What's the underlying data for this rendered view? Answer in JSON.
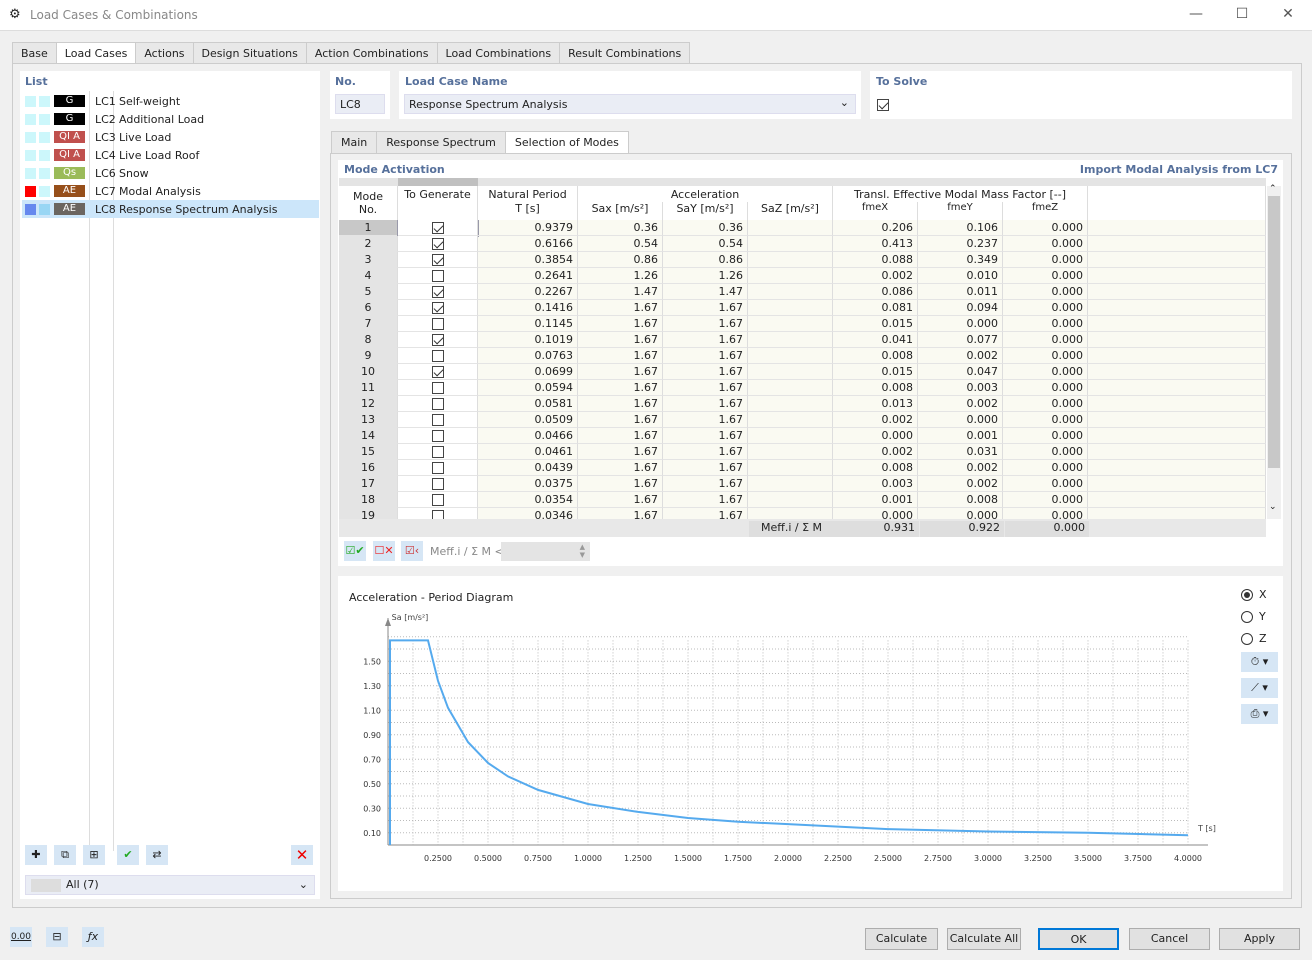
{
  "window": {
    "title": "Load Cases & Combinations",
    "minimize": "—",
    "maximize": "☐",
    "close": "✕"
  },
  "tabs": [
    "Base",
    "Load Cases",
    "Actions",
    "Design Situations",
    "Action Combinations",
    "Load Combinations",
    "Result Combinations"
  ],
  "active_tab": 1,
  "list": {
    "header": "List",
    "filter": "All (7)",
    "items": [
      {
        "id": "LC1",
        "name": "Self-weight",
        "badge": "G",
        "badge_color": "#000000",
        "c1": "#ccf7fb",
        "c2": "#ccf7fb"
      },
      {
        "id": "LC2",
        "name": "Additional Load",
        "badge": "G",
        "badge_color": "#000000",
        "c1": "#ccf7fb",
        "c2": "#ccf7fb"
      },
      {
        "id": "LC3",
        "name": "Live Load",
        "badge": "QI A",
        "badge_color": "#c0504d",
        "c1": "#ccf7fb",
        "c2": "#ccf7fb"
      },
      {
        "id": "LC4",
        "name": "Live Load Roof",
        "badge": "QI A",
        "badge_color": "#c0504d",
        "c1": "#ccf7fb",
        "c2": "#ccf7fb"
      },
      {
        "id": "LC6",
        "name": "Snow",
        "badge": "Qs",
        "badge_color": "#9bbb59",
        "c1": "#ccf7fb",
        "c2": "#ccf7fb"
      },
      {
        "id": "LC7",
        "name": "Modal Analysis",
        "badge": "AE",
        "badge_color": "#974f1a",
        "c1": "#ff0000",
        "c2": "#ccf7fb"
      },
      {
        "id": "LC8",
        "name": "Response Spectrum Analysis",
        "badge": "AE",
        "badge_color": "#6b6560",
        "c1": "#6688ee",
        "c2": "#99d6f4",
        "selected": true
      }
    ]
  },
  "form": {
    "no_label": "No.",
    "no_value": "LC8",
    "name_label": "Load Case Name",
    "name_value": "Response Spectrum Analysis",
    "solve_label": "To Solve",
    "solve_checked": true
  },
  "subtabs": [
    "Main",
    "Response Spectrum",
    "Selection of Modes"
  ],
  "active_subtab": 2,
  "modes": {
    "title": "Mode Activation",
    "import_link": "Import Modal Analysis from LC7",
    "headers": {
      "mode": "Mode\nNo.",
      "gen": "To Generate",
      "np": "Natural Period",
      "t": "T [s]",
      "acc": "Acceleration",
      "sax": "Sax [m/s²]",
      "say": "SaY [m/s²]",
      "saz": "SaZ [m/s²]",
      "mass": "Transl. Effective Modal Mass Factor [--]",
      "fx": "fmeX",
      "fy": "fmeY",
      "fz": "fmeZ"
    },
    "rows": [
      [
        1,
        true,
        "0.9379",
        "0.36",
        "0.36",
        "",
        "0.206",
        "0.106",
        "0.000"
      ],
      [
        2,
        true,
        "0.6166",
        "0.54",
        "0.54",
        "",
        "0.413",
        "0.237",
        "0.000"
      ],
      [
        3,
        true,
        "0.3854",
        "0.86",
        "0.86",
        "",
        "0.088",
        "0.349",
        "0.000"
      ],
      [
        4,
        false,
        "0.2641",
        "1.26",
        "1.26",
        "",
        "0.002",
        "0.010",
        "0.000"
      ],
      [
        5,
        true,
        "0.2267",
        "1.47",
        "1.47",
        "",
        "0.086",
        "0.011",
        "0.000"
      ],
      [
        6,
        true,
        "0.1416",
        "1.67",
        "1.67",
        "",
        "0.081",
        "0.094",
        "0.000"
      ],
      [
        7,
        false,
        "0.1145",
        "1.67",
        "1.67",
        "",
        "0.015",
        "0.000",
        "0.000"
      ],
      [
        8,
        true,
        "0.1019",
        "1.67",
        "1.67",
        "",
        "0.041",
        "0.077",
        "0.000"
      ],
      [
        9,
        false,
        "0.0763",
        "1.67",
        "1.67",
        "",
        "0.008",
        "0.002",
        "0.000"
      ],
      [
        10,
        true,
        "0.0699",
        "1.67",
        "1.67",
        "",
        "0.015",
        "0.047",
        "0.000"
      ],
      [
        11,
        false,
        "0.0594",
        "1.67",
        "1.67",
        "",
        "0.008",
        "0.003",
        "0.000"
      ],
      [
        12,
        false,
        "0.0581",
        "1.67",
        "1.67",
        "",
        "0.013",
        "0.002",
        "0.000"
      ],
      [
        13,
        false,
        "0.0509",
        "1.67",
        "1.67",
        "",
        "0.002",
        "0.000",
        "0.000"
      ],
      [
        14,
        false,
        "0.0466",
        "1.67",
        "1.67",
        "",
        "0.000",
        "0.001",
        "0.000"
      ],
      [
        15,
        false,
        "0.0461",
        "1.67",
        "1.67",
        "",
        "0.002",
        "0.031",
        "0.000"
      ],
      [
        16,
        false,
        "0.0439",
        "1.67",
        "1.67",
        "",
        "0.008",
        "0.002",
        "0.000"
      ],
      [
        17,
        false,
        "0.0375",
        "1.67",
        "1.67",
        "",
        "0.003",
        "0.002",
        "0.000"
      ],
      [
        18,
        false,
        "0.0354",
        "1.67",
        "1.67",
        "",
        "0.001",
        "0.008",
        "0.000"
      ],
      [
        19,
        false,
        "0.0346",
        "1.67",
        "1.67",
        "",
        "0.000",
        "0.000",
        "0.000"
      ]
    ],
    "sum_label": "Meff.i / Σ M",
    "sums": [
      "0.931",
      "0.922",
      "0.000"
    ],
    "filter_label": "Meff.i / Σ M <"
  },
  "chart_data": {
    "type": "line",
    "title": "Acceleration - Period Diagram",
    "ylabel": "Sa [m/s²]",
    "xlabel": "T [s]",
    "xlim": [
      0,
      4
    ],
    "ylim": [
      0,
      1.67
    ],
    "grid": true,
    "xticks": [
      "0.2500",
      "0.5000",
      "0.7500",
      "1.0000",
      "1.2500",
      "1.5000",
      "1.7500",
      "2.0000",
      "2.2500",
      "2.5000",
      "2.7500",
      "3.0000",
      "3.2500",
      "3.5000",
      "3.7500",
      "4.0000"
    ],
    "yticks": [
      "0.10",
      "0.30",
      "0.50",
      "0.70",
      "0.90",
      "1.10",
      "1.30",
      "1.50"
    ],
    "color": "#55aaee",
    "x": [
      0.01,
      0.01,
      0.2,
      0.25,
      0.3,
      0.4,
      0.5,
      0.6,
      0.75,
      1.0,
      1.25,
      1.5,
      1.75,
      2.0,
      2.5,
      3.0,
      3.5,
      4.0
    ],
    "y": [
      0,
      1.67,
      1.67,
      1.34,
      1.12,
      0.84,
      0.67,
      0.56,
      0.45,
      0.335,
      0.27,
      0.22,
      0.19,
      0.17,
      0.13,
      0.11,
      0.1,
      0.08
    ]
  },
  "direction": {
    "options": [
      "X",
      "Y",
      "Z"
    ],
    "selected": "X"
  },
  "footer": {
    "calculate": "Calculate",
    "calculate_all": "Calculate All",
    "ok": "OK",
    "cancel": "Cancel",
    "apply": "Apply",
    "units_icon": "0.00"
  }
}
